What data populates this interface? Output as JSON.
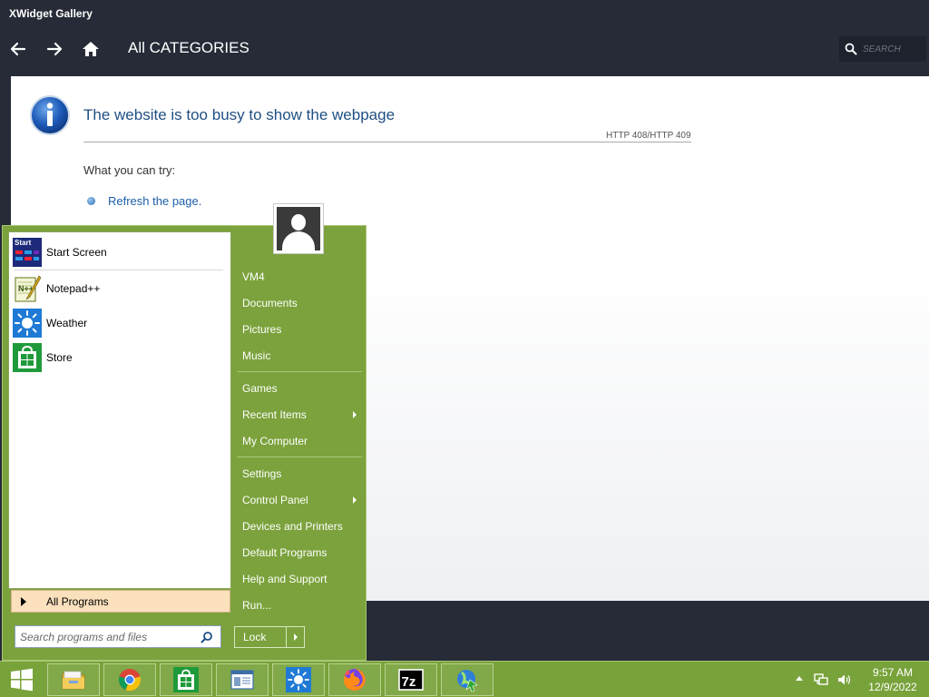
{
  "window": {
    "title": "XWidget Gallery"
  },
  "toolbar": {
    "category_title": "All CATEGORIES",
    "search_placeholder": "SEARCH"
  },
  "error_page": {
    "heading": "The website is too busy to show the webpage",
    "code": "HTTP 408/HTTP 409",
    "try_label": "What you can try:",
    "refresh_link": "Refresh the page."
  },
  "start_menu": {
    "pinned": [
      {
        "label": "Start Screen",
        "icon": "start-screen-icon"
      }
    ],
    "recent": [
      {
        "label": "Notepad++",
        "icon": "notepad-plus-icon"
      },
      {
        "label": "Weather",
        "icon": "weather-icon"
      },
      {
        "label": "Store",
        "icon": "store-icon"
      }
    ],
    "all_programs": "All Programs",
    "search_placeholder": "Search programs and files",
    "right_items": [
      {
        "label": "VM4"
      },
      {
        "label": "Documents"
      },
      {
        "label": "Pictures"
      },
      {
        "label": "Music"
      },
      {
        "label": "Games"
      },
      {
        "label": "Recent Items",
        "has_submenu": true
      },
      {
        "label": "My Computer"
      },
      {
        "label": "Settings"
      },
      {
        "label": "Control Panel",
        "has_submenu": true
      },
      {
        "label": "Devices and Printers"
      },
      {
        "label": "Default Programs"
      },
      {
        "label": "Help and Support"
      },
      {
        "label": "Run..."
      }
    ],
    "lock_label": "Lock"
  },
  "taskbar": {
    "apps": [
      {
        "name": "file-explorer",
        "icon": "folder-icon"
      },
      {
        "name": "chrome",
        "icon": "chrome-icon"
      },
      {
        "name": "store",
        "icon": "store-icon"
      },
      {
        "name": "window-app",
        "icon": "window-app-icon"
      },
      {
        "name": "weather",
        "icon": "weather-icon"
      },
      {
        "name": "firefox",
        "icon": "firefox-icon"
      },
      {
        "name": "7zip",
        "icon": "7zip-icon"
      },
      {
        "name": "xwidget",
        "icon": "xwidget-icon"
      }
    ],
    "clock_time": "9:57 AM",
    "clock_date": "12/9/2022"
  },
  "colors": {
    "start_menu_green": "#7ba23c",
    "taskbar_green": "#78a23a",
    "app_background": "#262b37",
    "error_heading_blue": "#1f4f83",
    "all_programs_highlight": "#fbe0bd"
  }
}
